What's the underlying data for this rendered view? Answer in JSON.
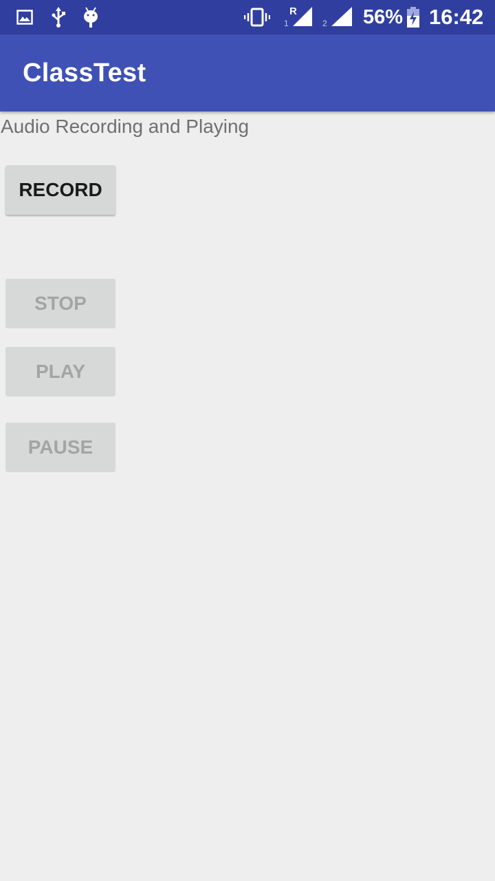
{
  "status_bar": {
    "sim1_label": "R",
    "sim1_index": "1",
    "sim2_index": "2",
    "battery": "56%",
    "time": "16:42",
    "icons": [
      "gallery-icon",
      "usb-icon",
      "android-debug-icon",
      "vibrate-icon",
      "signal-icon",
      "battery-charging-icon"
    ]
  },
  "app_bar": {
    "title": "ClassTest"
  },
  "main": {
    "heading": "Audio Recording and Playing",
    "buttons": {
      "record": "RECORD",
      "stop": "STOP",
      "play": "PLAY",
      "pause": "PAUSE"
    }
  },
  "colors": {
    "status_bar": "#303f9f",
    "app_bar": "#3f51b5",
    "background": "#eeeeee"
  }
}
